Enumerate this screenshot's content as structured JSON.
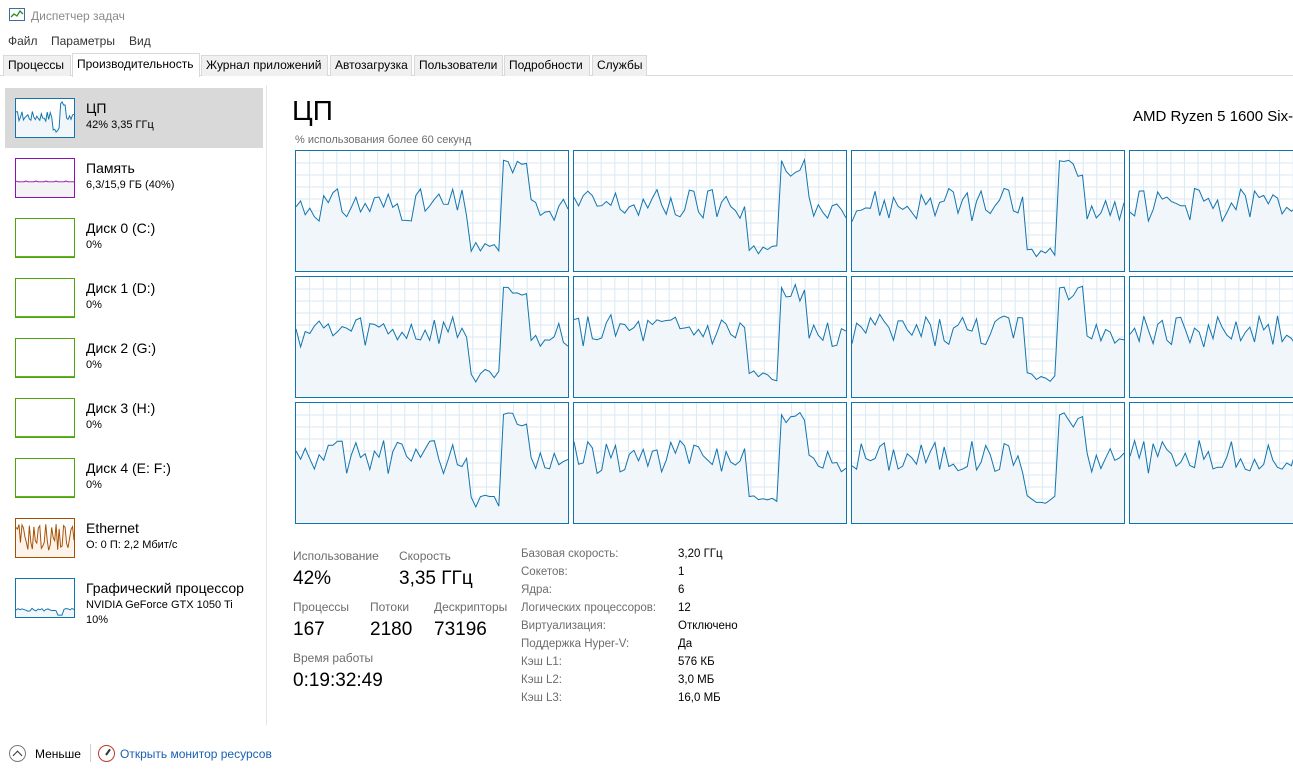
{
  "window": {
    "title": "Диспетчер задач"
  },
  "menu": [
    "Файл",
    "Параметры",
    "Вид"
  ],
  "tabs": [
    "Процессы",
    "Производительность",
    "Журнал приложений",
    "Автозагрузка",
    "Пользователи",
    "Подробности",
    "Службы"
  ],
  "active_tab": 1,
  "colors": {
    "cpu": "#1174ae",
    "memory": "#8b12ae",
    "disk": "#4da60c",
    "ethernet": "#a74f01",
    "gpu": "#1174ae",
    "selected": "#d9d9d9"
  },
  "sidebar": [
    {
      "title": "ЦП",
      "sub": "42%  3,35 ГГц",
      "sub2": "",
      "icon": "cpu-graph-icon"
    },
    {
      "title": "Память",
      "sub": "6,3/15,9 ГБ (40%)",
      "sub2": "",
      "icon": "memory-graph-icon"
    },
    {
      "title": "Диск 0 (C:)",
      "sub": "0%",
      "sub2": "",
      "icon": "disk-graph-icon"
    },
    {
      "title": "Диск 1 (D:)",
      "sub": "0%",
      "sub2": "",
      "icon": "disk-graph-icon"
    },
    {
      "title": "Диск 2 (G:)",
      "sub": "0%",
      "sub2": "",
      "icon": "disk-graph-icon"
    },
    {
      "title": "Диск 3 (H:)",
      "sub": "0%",
      "sub2": "",
      "icon": "disk-graph-icon"
    },
    {
      "title": "Диск 4 (E: F:)",
      "sub": "0%",
      "sub2": "",
      "icon": "disk-graph-icon"
    },
    {
      "title": "Ethernet",
      "sub": "О: 0 П: 2,2 Мбит/с",
      "sub2": "",
      "icon": "ethernet-graph-icon"
    },
    {
      "title": "Графический процессор",
      "sub": "NVIDIA GeForce GTX 1050 Ti",
      "sub2": "10%",
      "icon": "gpu-graph-icon"
    }
  ],
  "main": {
    "title": "ЦП",
    "cpu_model": "AMD Ryzen 5 1600 Six-",
    "graph_caption": "% использования более 60 секунд",
    "logical_cores": 12
  },
  "stats": {
    "usage_label": "Использование",
    "usage": "42%",
    "speed_label": "Скорость",
    "speed": "3,35 ГГц",
    "processes_label": "Процессы",
    "processes": "167",
    "threads_label": "Потоки",
    "threads": "2180",
    "handles_label": "Дескрипторы",
    "handles": "73196",
    "uptime_label": "Время работы",
    "uptime": "0:19:32:49"
  },
  "properties": [
    {
      "label": "Базовая скорость:",
      "value": "3,20 ГГц"
    },
    {
      "label": "Сокетов:",
      "value": "1"
    },
    {
      "label": "Ядра:",
      "value": "6"
    },
    {
      "label": "Логических процессоров:",
      "value": "12"
    },
    {
      "label": "Виртуализация:",
      "value": "Отключено"
    },
    {
      "label": "Поддержка Hyper-V:",
      "value": "Да"
    },
    {
      "label": "Кэш L1:",
      "value": "576 КБ"
    },
    {
      "label": "Кэш L2:",
      "value": "3,0 МБ"
    },
    {
      "label": "Кэш L3:",
      "value": "16,0 МБ"
    }
  ],
  "footer": {
    "less": "Меньше",
    "monitor_link": "Открыть монитор ресурсов"
  }
}
